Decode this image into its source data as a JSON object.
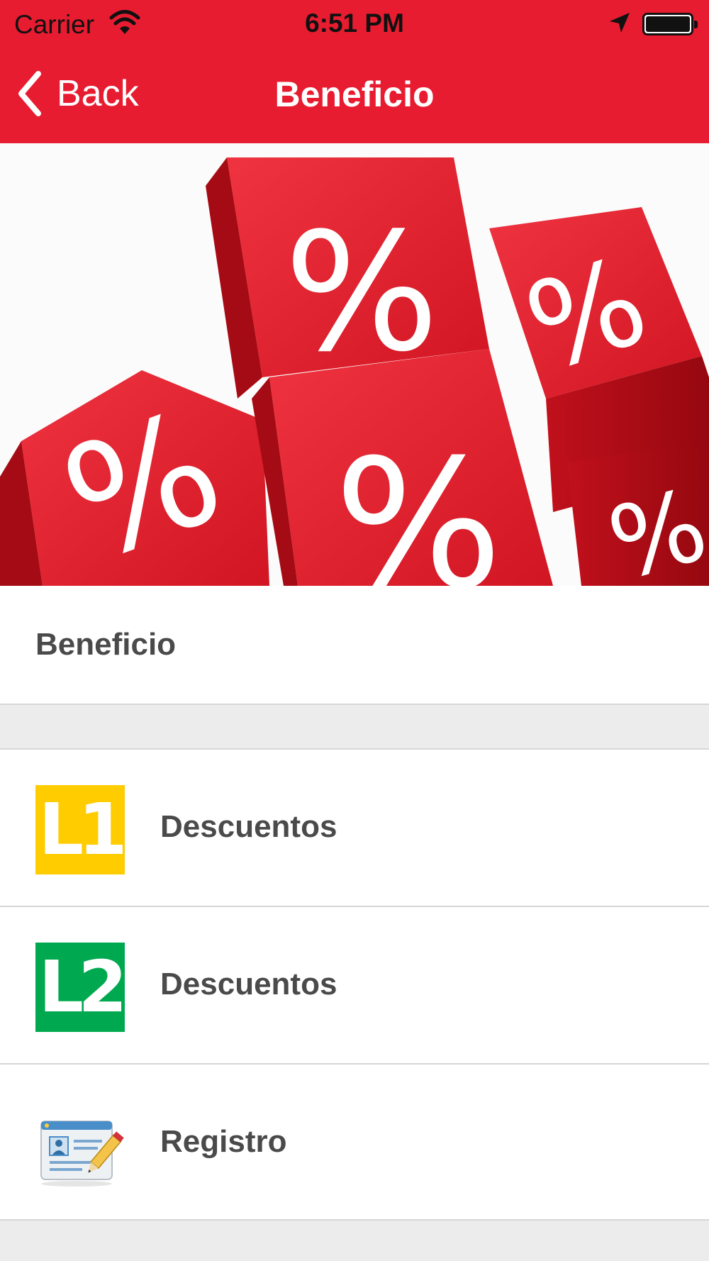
{
  "status_bar": {
    "carrier": "Carrier",
    "time": "6:51 PM"
  },
  "nav": {
    "back_label": "Back",
    "title": "Beneficio",
    "background": "#e81c30"
  },
  "banner": {
    "icon": "percent-dice-image",
    "colors": {
      "die": "#d41421",
      "symbol": "#ffffff"
    }
  },
  "section": {
    "title": "Beneficio"
  },
  "items": [
    {
      "badge": "L1",
      "badge_color": "#ffcc00",
      "label": "Descuentos",
      "icon": "line-1-badge-icon"
    },
    {
      "badge": "L2",
      "badge_color": "#00a94f",
      "label": "Descuentos",
      "icon": "line-2-badge-icon"
    },
    {
      "badge": "",
      "label": "Registro",
      "icon": "registration-form-icon"
    }
  ]
}
